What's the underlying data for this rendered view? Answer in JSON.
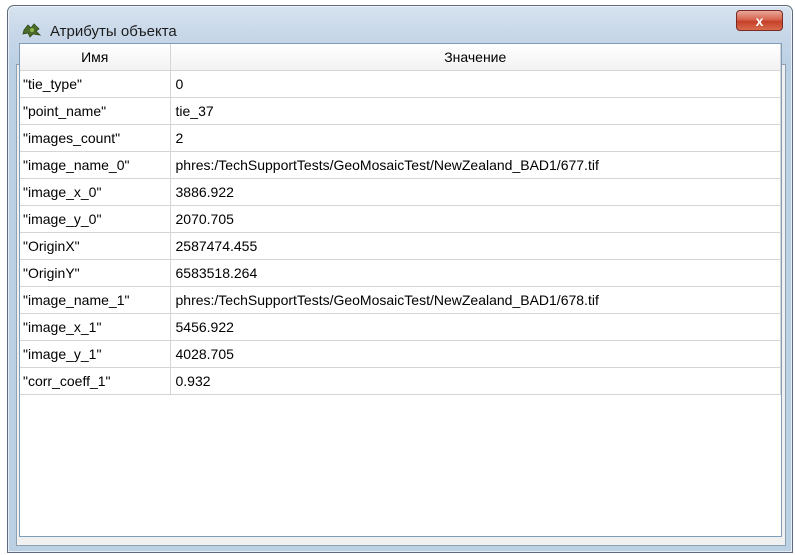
{
  "window": {
    "title": "Атрибуты объекта",
    "close_label": "x"
  },
  "toolbar": {
    "buttons": [
      {
        "icon": "copy-icon"
      },
      {
        "icon": "new-document-icon"
      },
      {
        "icon": "import-icon"
      },
      {
        "icon": "export-icon"
      },
      {
        "icon": "edit-icon"
      },
      {
        "icon": "sort-icon"
      },
      {
        "icon": "column-settings-icon"
      }
    ]
  },
  "grid": {
    "headers": [
      "Имя",
      "Значение"
    ],
    "rows": [
      {
        "name": "\"tie_type\"",
        "value": "0"
      },
      {
        "name": "\"point_name\"",
        "value": "tie_37"
      },
      {
        "name": "\"images_count\"",
        "value": "2"
      },
      {
        "name": "\"image_name_0\"",
        "value": "phres:/TechSupportTests/GeoMosaicTest/NewZealand_BAD1/677.tif"
      },
      {
        "name": "\"image_x_0\"",
        "value": "3886.922"
      },
      {
        "name": "\"image_y_0\"",
        "value": "2070.705"
      },
      {
        "name": "\"OriginX\"",
        "value": "2587474.455"
      },
      {
        "name": "\"OriginY\"",
        "value": "6583518.264"
      },
      {
        "name": "\"image_name_1\"",
        "value": "phres:/TechSupportTests/GeoMosaicTest/NewZealand_BAD1/678.tif"
      },
      {
        "name": "\"image_x_1\"",
        "value": "5456.922"
      },
      {
        "name": "\"image_y_1\"",
        "value": "4028.705"
      },
      {
        "name": "\"corr_coeff_1\"",
        "value": "0.932"
      }
    ]
  }
}
